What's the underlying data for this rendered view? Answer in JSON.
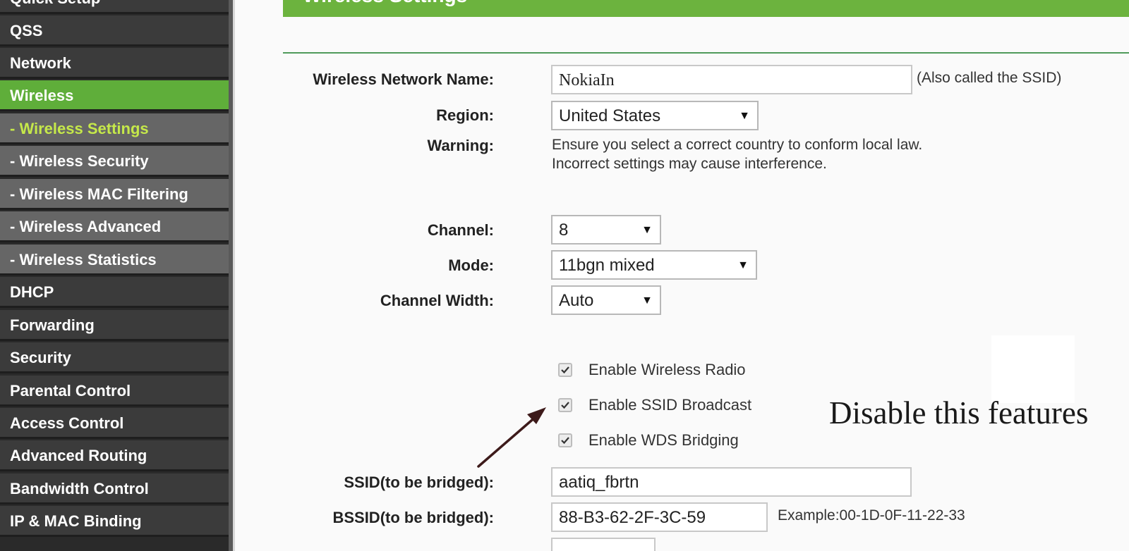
{
  "sidebar": {
    "items": [
      {
        "label": "Quick Setup"
      },
      {
        "label": "QSS"
      },
      {
        "label": "Network"
      },
      {
        "label": "Wireless"
      },
      {
        "label": "- Wireless Settings"
      },
      {
        "label": "- Wireless Security"
      },
      {
        "label": "- Wireless MAC Filtering"
      },
      {
        "label": "- Wireless Advanced"
      },
      {
        "label": "- Wireless Statistics"
      },
      {
        "label": "DHCP"
      },
      {
        "label": "Forwarding"
      },
      {
        "label": "Security"
      },
      {
        "label": "Parental Control"
      },
      {
        "label": "Access Control"
      },
      {
        "label": "Advanced Routing"
      },
      {
        "label": "Bandwidth Control"
      },
      {
        "label": "IP & MAC Binding"
      }
    ]
  },
  "page": {
    "title": "Wireless Settings"
  },
  "form": {
    "network_name_label": "Wireless Network Name:",
    "network_name_value": "NokiaIn",
    "network_name_hint": "(Also called the SSID)",
    "region_label": "Region:",
    "region_value": "United States",
    "warning_label": "Warning:",
    "warning_line1": "Ensure you select a correct country to conform local law.",
    "warning_line2": "Incorrect settings may cause interference.",
    "channel_label": "Channel:",
    "channel_value": "8",
    "mode_label": "Mode:",
    "mode_value": "11bgn mixed",
    "channel_width_label": "Channel Width:",
    "channel_width_value": "Auto",
    "enable_radio_label": "Enable Wireless Radio",
    "enable_radio_checked": true,
    "enable_ssid_label": "Enable SSID Broadcast",
    "enable_ssid_checked": true,
    "enable_wds_label": "Enable WDS Bridging",
    "enable_wds_checked": true,
    "ssid_bridged_label": "SSID(to be bridged):",
    "ssid_bridged_value": "aatiq_fbrtn",
    "bssid_bridged_label": "BSSID(to be bridged):",
    "bssid_bridged_value": "88-B3-62-2F-3C-59",
    "bssid_hint": "Example:00-1D-0F-11-22-33"
  },
  "annotation": {
    "text": "Disable this features"
  },
  "colors": {
    "accent_green": "#6cb33e",
    "selected_subitem": "#c5e84a",
    "arrow": "#3d1a1a"
  }
}
